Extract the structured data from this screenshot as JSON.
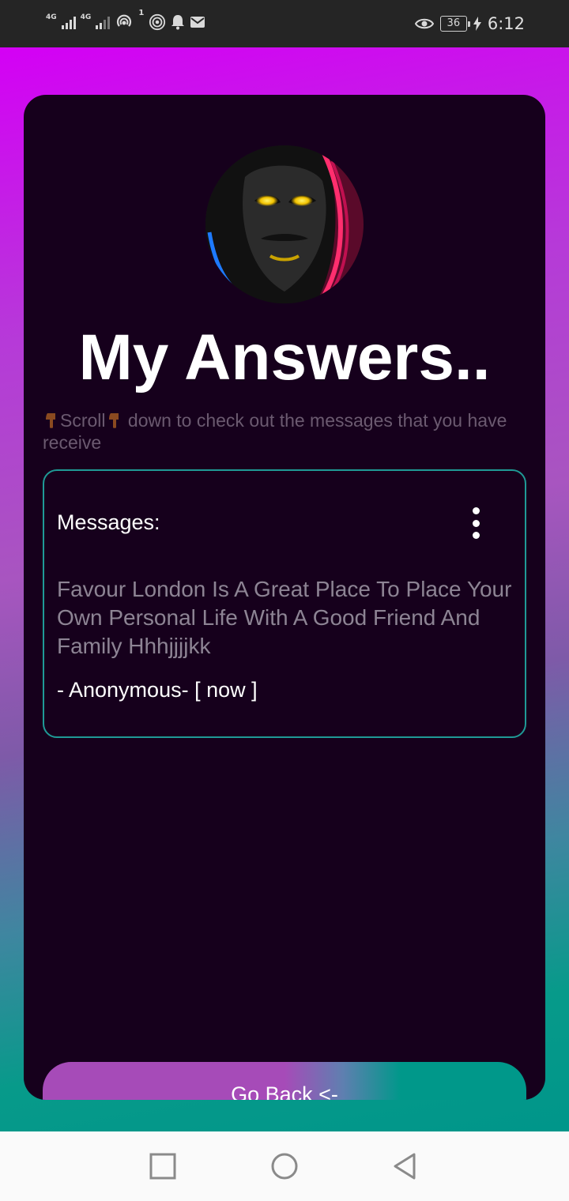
{
  "status_bar": {
    "network_1": "4G",
    "network_2": "4G",
    "hotspot_badge": "1",
    "battery": "36",
    "time": "6:12",
    "icons": [
      "signal-icon",
      "signal-icon",
      "hotspot-icon",
      "wifi-hotspot-icon",
      "notification-bell-icon",
      "mail-icon",
      "eye-icon",
      "battery-icon",
      "charging-icon"
    ]
  },
  "page": {
    "title": "My Answers..",
    "subtitle_scroll": "Scroll",
    "subtitle_rest": " down to check out the messages that you have receive"
  },
  "message_card": {
    "label": "Messages:",
    "text": "Favour London Is A Great Place To Place Your Own Personal Life With A Good Friend And Family Hhhjjjjkk",
    "meta": "- Anonymous- [ now ]"
  },
  "actions": {
    "go_back": "Go Back  <-"
  },
  "colors": {
    "card_bg": "#16001c",
    "border_accent": "#1f9a96",
    "gradient_top": "#d400f5",
    "gradient_bottom": "#00968a"
  }
}
